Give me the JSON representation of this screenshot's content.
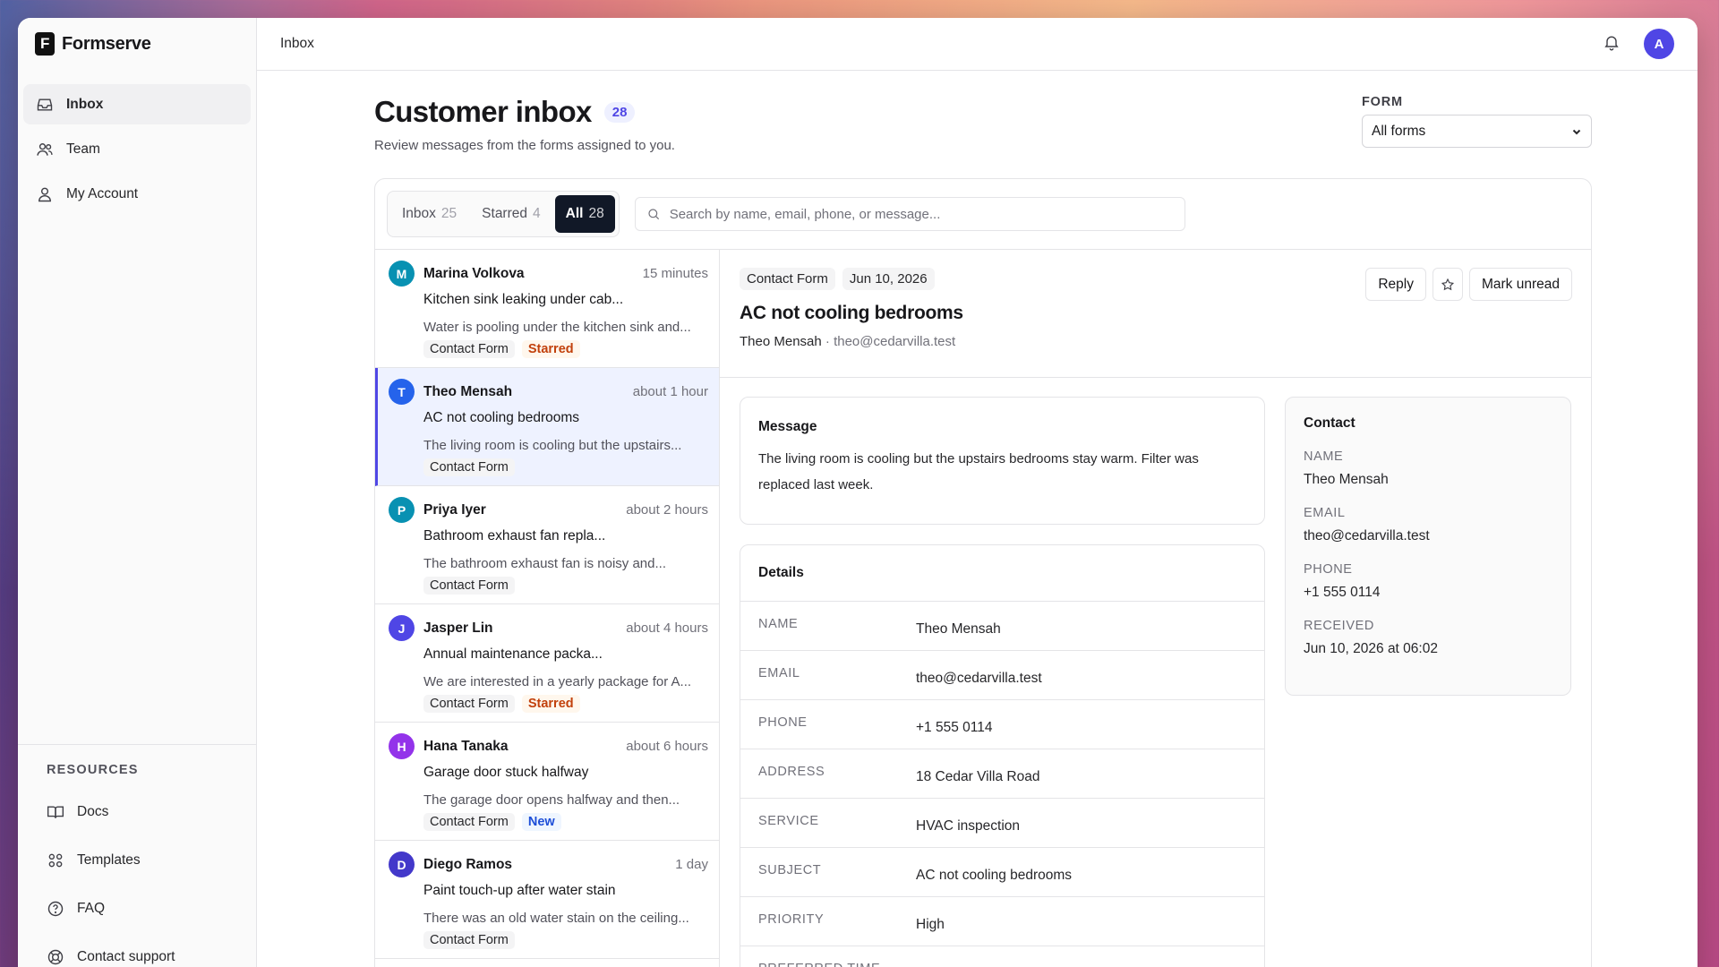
{
  "app": {
    "brand": "Formserve",
    "brand_letter": "F",
    "user_initial": "A"
  },
  "topbar": {
    "title": "Inbox"
  },
  "nav": [
    {
      "label": "Inbox",
      "icon": "inbox-icon",
      "active": true
    },
    {
      "label": "Team",
      "icon": "users-icon",
      "active": false
    },
    {
      "label": "My Account",
      "icon": "user-icon",
      "active": false
    }
  ],
  "resources": {
    "title": "RESOURCES",
    "items": [
      {
        "label": "Docs",
        "icon": "book-icon"
      },
      {
        "label": "Templates",
        "icon": "grid-icon"
      },
      {
        "label": "FAQ",
        "icon": "help-circle-icon"
      },
      {
        "label": "Contact support",
        "icon": "lifebuoy-icon"
      }
    ]
  },
  "page": {
    "title": "Customer inbox",
    "count": "28",
    "subtitle": "Review messages from the forms assigned to you.",
    "form_label": "FORM",
    "form_value": "All forms"
  },
  "tabs": [
    {
      "label": "Inbox",
      "count": "25",
      "active": false
    },
    {
      "label": "Starred",
      "count": "4",
      "active": false
    },
    {
      "label": "All",
      "count": "28",
      "active": true
    }
  ],
  "search": {
    "placeholder": "Search by name, email, phone, or message..."
  },
  "messages": [
    {
      "initial": "M",
      "color": "#0891b2",
      "name": "Marina Volkova",
      "time": "15 minutes",
      "subject": "Kitchen sink leaking under cab...",
      "preview": "Water is pooling under the kitchen sink and...",
      "tags": [
        {
          "label": "Contact Form",
          "kind": "form"
        },
        {
          "label": "Starred",
          "kind": "starred"
        }
      ]
    },
    {
      "initial": "T",
      "color": "#2563eb",
      "name": "Theo Mensah",
      "time": "about 1 hour",
      "subject": "AC not cooling bedrooms",
      "preview": "The living room is cooling but the upstairs...",
      "selected": true,
      "tags": [
        {
          "label": "Contact Form",
          "kind": "form"
        }
      ]
    },
    {
      "initial": "P",
      "color": "#0891b2",
      "name": "Priya Iyer",
      "time": "about 2 hours",
      "subject": "Bathroom exhaust fan repla...",
      "preview": "The bathroom exhaust fan is noisy and...",
      "tags": [
        {
          "label": "Contact Form",
          "kind": "form"
        }
      ]
    },
    {
      "initial": "J",
      "color": "#4f46e5",
      "name": "Jasper Lin",
      "time": "about 4 hours",
      "subject": "Annual maintenance packa...",
      "preview": "We are interested in a yearly package for A...",
      "tags": [
        {
          "label": "Contact Form",
          "kind": "form"
        },
        {
          "label": "Starred",
          "kind": "starred"
        }
      ]
    },
    {
      "initial": "H",
      "color": "#9333ea",
      "name": "Hana Tanaka",
      "time": "about 6 hours",
      "subject": "Garage door stuck halfway",
      "preview": "The garage door opens halfway and then...",
      "tags": [
        {
          "label": "Contact Form",
          "kind": "form"
        },
        {
          "label": "New",
          "kind": "new"
        }
      ]
    },
    {
      "initial": "D",
      "color": "#4338ca",
      "name": "Diego Ramos",
      "time": "1 day",
      "subject": "Paint touch-up after water stain",
      "preview": "There was an old water stain on the ceiling...",
      "tags": [
        {
          "label": "Contact Form",
          "kind": "form"
        }
      ]
    }
  ],
  "detail": {
    "form": "Contact Form",
    "date": "Jun 10, 2026",
    "title": "AC not cooling bedrooms",
    "from_name": "Theo Mensah",
    "from_email": "· theo@cedarvilla.test",
    "actions": {
      "reply": "Reply",
      "mark_unread": "Mark unread"
    },
    "message_title": "Message",
    "message_body": "The living room is cooling but the upstairs bedrooms stay warm. Filter was replaced last week.",
    "details_title": "Details",
    "fields": [
      {
        "key": "NAME",
        "value": "Theo Mensah"
      },
      {
        "key": "EMAIL",
        "value": "theo@cedarvilla.test"
      },
      {
        "key": "PHONE",
        "value": "+1 555 0114"
      },
      {
        "key": "ADDRESS",
        "value": "18 Cedar Villa Road"
      },
      {
        "key": "SERVICE",
        "value": "HVAC inspection"
      },
      {
        "key": "SUBJECT",
        "value": "AC not cooling bedrooms"
      },
      {
        "key": "PRIORITY",
        "value": "High"
      },
      {
        "key": "PREFERRED TIME",
        "value": ""
      }
    ],
    "contact": {
      "title": "Contact",
      "name_label": "NAME",
      "name": "Theo Mensah",
      "email_label": "EMAIL",
      "email": "theo@cedarvilla.test",
      "phone_label": "PHONE",
      "phone": "+1 555 0114",
      "received_label": "RECEIVED",
      "received": "Jun 10, 2026 at 06:02"
    }
  }
}
